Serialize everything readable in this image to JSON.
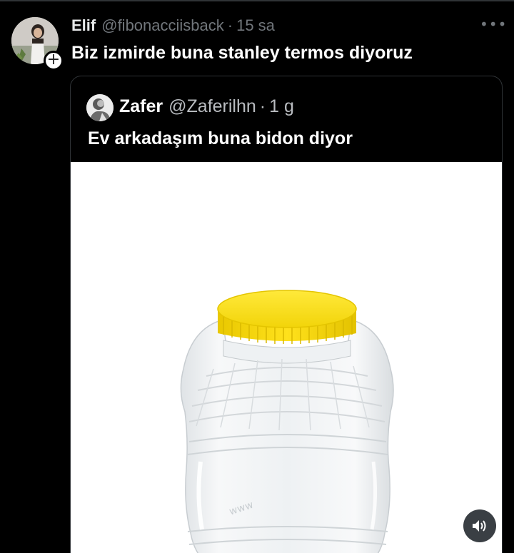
{
  "tweet": {
    "author_name": "Elif",
    "handle": "@fibonacciisback",
    "separator": "·",
    "time": "15 sa",
    "text": "Biz izmirde buna stanley termos diyoruz",
    "more_icon": "more-horizontal-icon",
    "follow_icon": "plus-icon"
  },
  "quoted_tweet": {
    "author_name": "Zafer",
    "handle": "@Zaferilhn",
    "separator": "·",
    "time": "1 g",
    "text": "Ev arkadaşım buna bidon diyor",
    "media": {
      "subject": "plastic-jar",
      "lid_color": "#f7df16",
      "sound_icon": "volume-icon"
    }
  }
}
